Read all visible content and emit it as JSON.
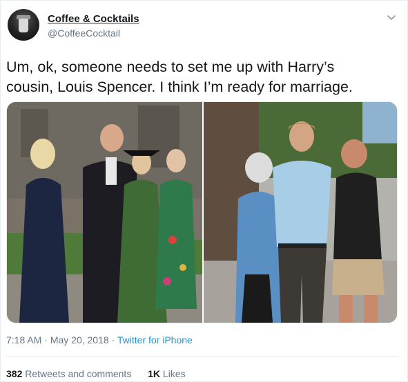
{
  "account": {
    "name": "Coffee & Cocktails",
    "handle": "@CoffeeCocktail",
    "avatar_icon": "cocktail-glass-icon"
  },
  "tweet": {
    "text_line1": "Um, ok, someone needs to set me up with Harry’s",
    "text_line2": "cousin, Louis Spencer. I think I’m ready for marriage."
  },
  "meta": {
    "time": "7:18 AM",
    "separator": "·",
    "date": "May 20, 2018",
    "source": "Twitter for iPhone"
  },
  "stats": {
    "retweets_count": "382",
    "retweets_label": "Retweets and comments",
    "likes_count": "1K",
    "likes_label": "Likes"
  },
  "colors": {
    "link": "#1b95e0",
    "muted": "#657786",
    "text": "#14171a",
    "border": "#e6ecf0"
  }
}
